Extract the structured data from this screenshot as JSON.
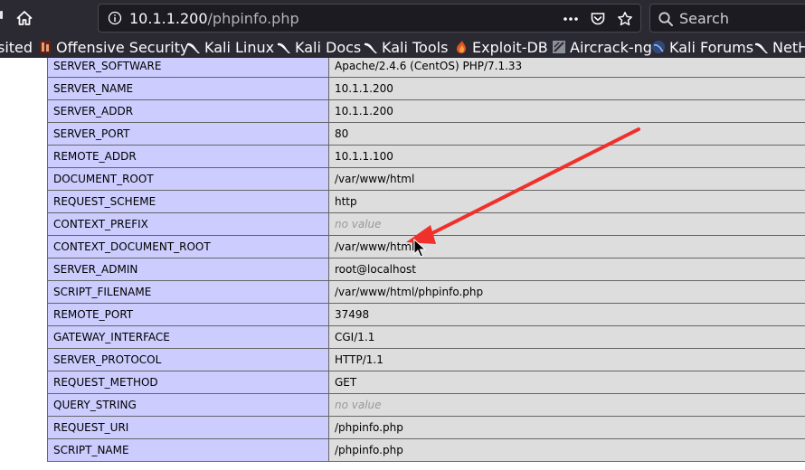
{
  "browser": {
    "url_host": "10.1.1.200",
    "url_path": "/phpinfo.php",
    "search_placeholder": "Search",
    "bookmarks": [
      {
        "label": "sited",
        "icon": "none"
      },
      {
        "label": "Offensive Security",
        "icon": "offsec-icon"
      },
      {
        "label": "Kali Linux",
        "icon": "kali-dragon-icon"
      },
      {
        "label": "Kali Docs",
        "icon": "kali-dragon-icon"
      },
      {
        "label": "Kali Tools",
        "icon": "kali-dragon-icon"
      },
      {
        "label": "Exploit-DB",
        "icon": "exploit-db-icon"
      },
      {
        "label": "Aircrack-ng",
        "icon": "aircrack-icon"
      },
      {
        "label": "Kali Forums",
        "icon": "kali-forums-icon"
      },
      {
        "label": "NetH",
        "icon": "kali-dragon-icon"
      }
    ]
  },
  "phpinfo": {
    "rows": [
      {
        "key": "SERVER_SOFTWARE",
        "value": "Apache/2.4.6 (CentOS) PHP/7.1.33",
        "no_value": false
      },
      {
        "key": "SERVER_NAME",
        "value": "10.1.1.200",
        "no_value": false
      },
      {
        "key": "SERVER_ADDR",
        "value": "10.1.1.200",
        "no_value": false
      },
      {
        "key": "SERVER_PORT",
        "value": "80",
        "no_value": false
      },
      {
        "key": "REMOTE_ADDR",
        "value": "10.1.1.100",
        "no_value": false
      },
      {
        "key": "DOCUMENT_ROOT",
        "value": "/var/www/html",
        "no_value": false
      },
      {
        "key": "REQUEST_SCHEME",
        "value": "http",
        "no_value": false
      },
      {
        "key": "CONTEXT_PREFIX",
        "value": "no value",
        "no_value": true
      },
      {
        "key": "CONTEXT_DOCUMENT_ROOT",
        "value": "/var/www/html",
        "no_value": false
      },
      {
        "key": "SERVER_ADMIN",
        "value": "root@localhost",
        "no_value": false
      },
      {
        "key": "SCRIPT_FILENAME",
        "value": "/var/www/html/phpinfo.php",
        "no_value": false
      },
      {
        "key": "REMOTE_PORT",
        "value": "37498",
        "no_value": false
      },
      {
        "key": "GATEWAY_INTERFACE",
        "value": "CGI/1.1",
        "no_value": false
      },
      {
        "key": "SERVER_PROTOCOL",
        "value": "HTTP/1.1",
        "no_value": false
      },
      {
        "key": "REQUEST_METHOD",
        "value": "GET",
        "no_value": false
      },
      {
        "key": "QUERY_STRING",
        "value": "no value",
        "no_value": true
      },
      {
        "key": "REQUEST_URI",
        "value": "/phpinfo.php",
        "no_value": false
      },
      {
        "key": "SCRIPT_NAME",
        "value": "/phpinfo.php",
        "no_value": false
      }
    ]
  },
  "colors": {
    "toolbar_bg": "#2b2a33",
    "key_cell_bg": "#ccccff",
    "value_cell_bg": "#dddddd",
    "annotation_arrow": "#f0302a"
  }
}
